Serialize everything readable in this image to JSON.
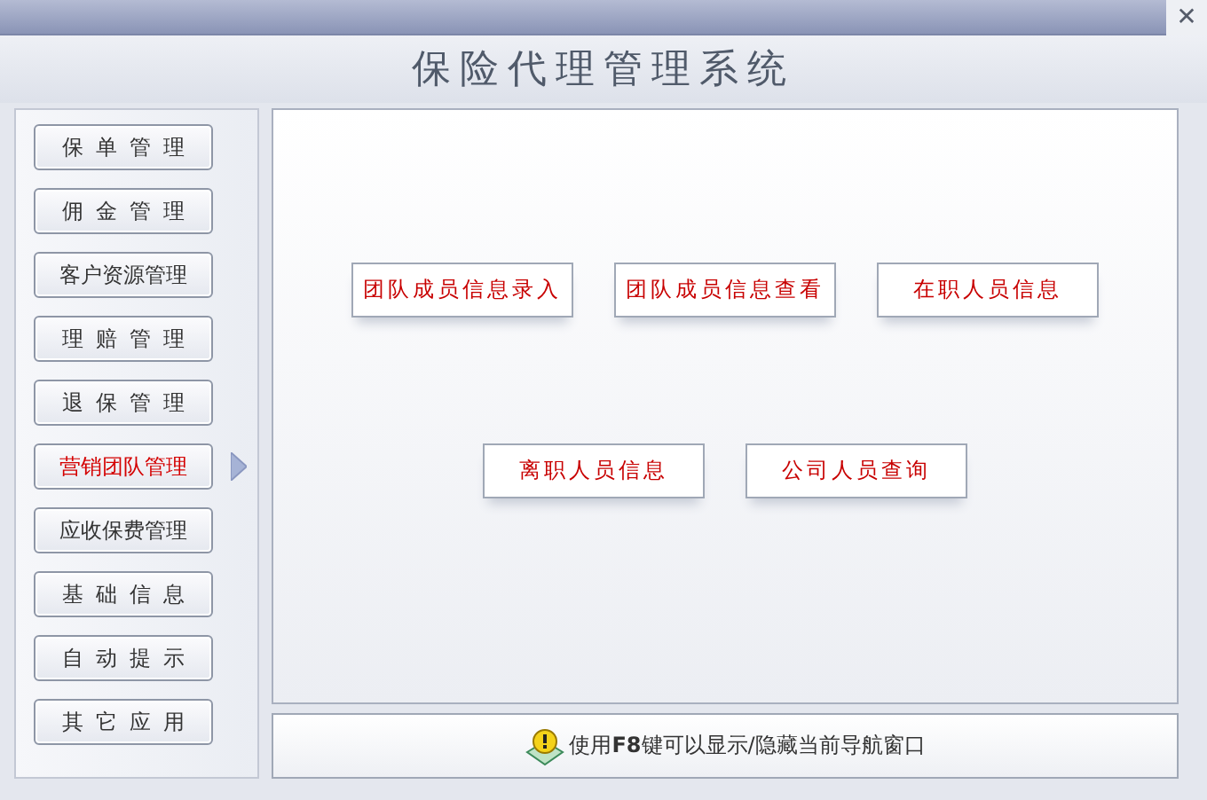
{
  "window": {
    "title": "保险代理管理系统",
    "close": "✕"
  },
  "sidebar": {
    "items": [
      {
        "label": "保单管理",
        "selected": false
      },
      {
        "label": "佣金管理",
        "selected": false
      },
      {
        "label": "客户资源管理",
        "selected": false
      },
      {
        "label": "理赔管理",
        "selected": false
      },
      {
        "label": "退保管理",
        "selected": false
      },
      {
        "label": "营销团队管理",
        "selected": true
      },
      {
        "label": "应收保费管理",
        "selected": false
      },
      {
        "label": "基础信息",
        "selected": false
      },
      {
        "label": "自动提示",
        "selected": false
      },
      {
        "label": "其它应用",
        "selected": false
      }
    ]
  },
  "content": {
    "rows": [
      [
        "团队成员信息录入",
        "团队成员信息查看",
        "在职人员信息"
      ],
      [
        "离职人员信息",
        "公司人员查询"
      ]
    ]
  },
  "status_bar": {
    "text": "使用**F8**键可以显示/隐藏当前导航窗口"
  }
}
